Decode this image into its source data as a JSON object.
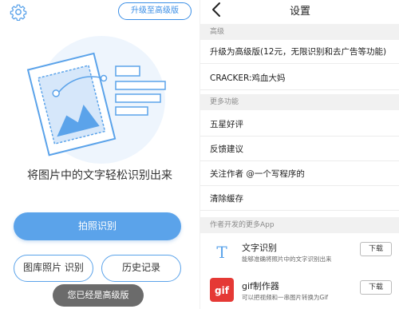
{
  "colors": {
    "accent": "#5ba3ea",
    "accent_dark": "#3a8ee6",
    "hero_bg": "#eef5fd",
    "section_bg": "#f1f1f1",
    "toast_bg": "#6b6b6b",
    "gif_red": "#e53935"
  },
  "left": {
    "settings_icon": "gear-icon",
    "upgrade_button": "升级至高级版",
    "tagline": "将图片中的文字轻松识别出来",
    "camera_button": "拍照识别",
    "gallery_button": "图库照片 识别",
    "history_button": "历史记录",
    "toast": "您已经是高级版"
  },
  "right": {
    "back_icon": "chevron-left-icon",
    "title": "设置",
    "section_advanced": "高级",
    "upgrade_row": "升级为高级版(12元，无限识别和去广告等功能)",
    "cracker_row": "CRACKER:鸡血大妈",
    "section_more": "更多功能",
    "rate_row": "五星好评",
    "feedback_row": "反馈建议",
    "follow_row": "关注作者 @一个写程序的",
    "clear_row": "清除缓存",
    "section_apps": "作者开发的更多App",
    "apps": [
      {
        "name": "文字识别",
        "desc": "能够准确将照片中的文字识别出来",
        "download": "下载",
        "icon_text": "T"
      },
      {
        "name": "gif制作器",
        "desc": "可以把视频和一串图片转换为Gif",
        "download": "下载",
        "icon_text": "gif"
      }
    ]
  }
}
